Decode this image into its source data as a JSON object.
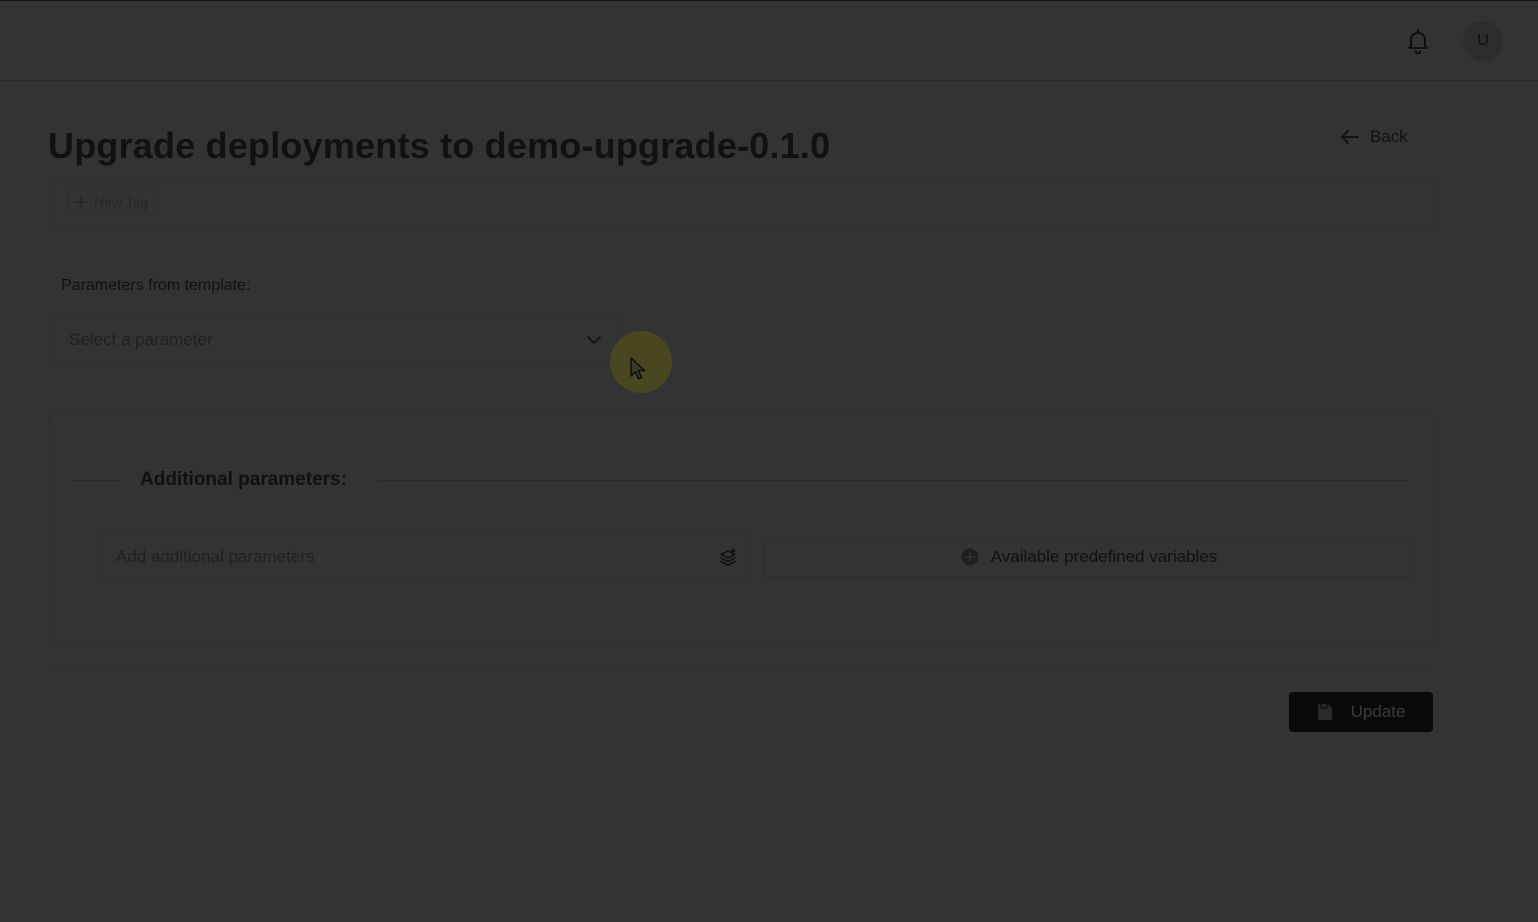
{
  "header": {
    "notifications_icon": "bell-icon",
    "avatar_initial": "U"
  },
  "page": {
    "title": "Upgrade deployments to demo-upgrade-0.1.0",
    "back_label": "Back"
  },
  "tags": {
    "new_tag_label": "New Tag"
  },
  "template_params": {
    "label": "Parameters from template:",
    "select_placeholder": "Select a parameter"
  },
  "additional": {
    "title": "Additional parameters:",
    "input_placeholder": "Add additional parameters",
    "predefined_label": "Available predefined variables"
  },
  "actions": {
    "update_label": "Update"
  },
  "colors": {
    "overlay_background": "#333334",
    "primary_button": "#0a0a0a",
    "cursor_highlight": "#48471f"
  }
}
